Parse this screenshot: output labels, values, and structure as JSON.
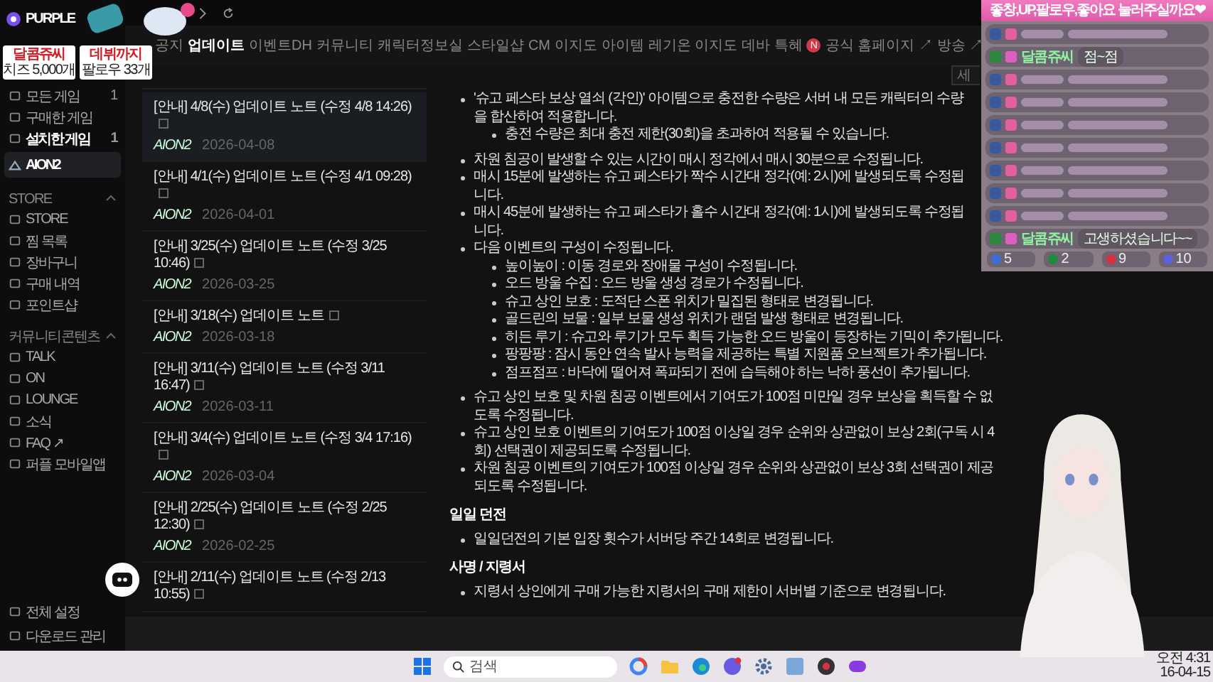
{
  "stream_overlay": {
    "cards": [
      {
        "title": "달콤쥬씨",
        "value": "치즈 5,000개"
      },
      {
        "title": "데뷔까지",
        "value": "팔로우 33개"
      }
    ]
  },
  "sidebar": {
    "logo": "PURPLE",
    "groups": [
      {
        "items": [
          {
            "label": "모든 게임",
            "badge": "1",
            "emphasized": false,
            "selected": false,
            "kind": "item"
          },
          {
            "label": "구매한 게임",
            "emphasized": false,
            "selected": false,
            "kind": "item"
          },
          {
            "label": "설치한 게임",
            "badge": "1",
            "emphasized": true,
            "selected": false,
            "kind": "item"
          },
          {
            "label": "AION2",
            "emphasized": true,
            "selected": true,
            "kind": "game"
          }
        ]
      },
      {
        "title": "STORE",
        "items": [
          {
            "label": "STORE",
            "emphasized": false,
            "selected": false,
            "kind": "item"
          },
          {
            "label": "찜 목록",
            "emphasized": false,
            "selected": false,
            "kind": "item"
          },
          {
            "label": "장바구니",
            "emphasized": false,
            "selected": false,
            "kind": "item"
          },
          {
            "label": "구매 내역",
            "emphasized": false,
            "selected": false,
            "kind": "item"
          },
          {
            "label": "포인트샵",
            "emphasized": false,
            "selected": false,
            "kind": "item"
          }
        ]
      },
      {
        "title": "커뮤니티콘텐츠",
        "items": [
          {
            "label": "TALK",
            "emphasized": false,
            "selected": false,
            "kind": "item"
          },
          {
            "label": "ON",
            "emphasized": false,
            "selected": false,
            "kind": "item"
          },
          {
            "label": "LOUNGE",
            "emphasized": false,
            "selected": false,
            "kind": "item"
          },
          {
            "label": "소식",
            "emphasized": false,
            "selected": false,
            "kind": "item"
          },
          {
            "label": "FAQ ↗",
            "emphasized": false,
            "selected": false,
            "kind": "item"
          },
          {
            "label": "퍼플 모바일앱",
            "emphasized": false,
            "selected": false,
            "kind": "item"
          }
        ]
      }
    ],
    "footer": [
      {
        "label": "전체 설정"
      },
      {
        "label": "다운로드 관리"
      }
    ]
  },
  "tabs": [
    {
      "label": "공지",
      "selected": false
    },
    {
      "label": "업데이트",
      "selected": true
    },
    {
      "label": "이벤트DH",
      "selected": false
    },
    {
      "label": "커뮤니티",
      "selected": false
    },
    {
      "label": "캐릭터정보실",
      "selected": false
    },
    {
      "label": "스타일샵",
      "selected": false
    },
    {
      "label": "CM 이지도",
      "selected": false
    },
    {
      "label": "아이템",
      "selected": false
    },
    {
      "label": "레기온 이지도",
      "selected": false
    },
    {
      "label": "데바 특혜",
      "badge": "N",
      "selected": false
    },
    {
      "label": "공식 홈페이지 ↗",
      "selected": false
    },
    {
      "label": "방송 ↗",
      "selected": false
    }
  ],
  "search": {
    "placeholder": "세"
  },
  "posts": [
    {
      "title": "[안내] 4/8(수) 업데이트 노트 (수정 4/8 14:26)",
      "logo": "AION2",
      "date": "2026-04-08",
      "selected": true
    },
    {
      "title": "[안내] 4/1(수) 업데이트 노트 (수정 4/1 09:28)",
      "logo": "AION2",
      "date": "2026-04-01",
      "selected": false
    },
    {
      "title": "[안내] 3/25(수) 업데이트 노트 (수정 3/25 10:46)",
      "logo": "AION2",
      "date": "2026-03-25",
      "selected": false
    },
    {
      "title": "[안내] 3/18(수) 업데이트 노트",
      "logo": "AION2",
      "date": "2026-03-18",
      "selected": false
    },
    {
      "title": "[안내] 3/11(수) 업데이트 노트 (수정 3/11 16:47)",
      "logo": "AION2",
      "date": "2026-03-11",
      "selected": false
    },
    {
      "title": "[안내] 3/4(수) 업데이트 노트 (수정 3/4 17:16)",
      "logo": "AION2",
      "date": "2026-03-04",
      "selected": false
    },
    {
      "title": "[안내] 2/25(수) 업데이트 노트 (수정 2/25 12:30)",
      "logo": "AION2",
      "date": "2026-02-25",
      "selected": false
    },
    {
      "title": "[안내] 2/11(수) 업데이트 노트 (수정 2/13 10:55)",
      "selected": false
    }
  ],
  "article": {
    "blocks": [
      {
        "kind": "list",
        "items": [
          {
            "text": "'슈고 페스타 보상 열쇠 (각인)' 아이템으로 충전한 수량은 서버 내 모든 캐릭터의 수량을 합산하여 적용합니다.",
            "children": [
              "충전 수량은 최대 충전 제한(30회)을 초과하여 적용될 수 있습니다."
            ]
          }
        ]
      },
      {
        "kind": "list",
        "items": [
          {
            "text": "차원 침공이 발생할 수 있는 시간이 매시 정각에서 매시 30분으로 수정됩니다."
          },
          {
            "text": "매시 15분에 발생하는 슈고 페스타가 짝수 시간대 정각(예: 2시)에 발생되도록 수정됩니다."
          },
          {
            "text": "매시 45분에 발생하는 슈고 페스타가 홀수 시간대 정각(예: 1시)에 발생되도록 수정됩니다."
          },
          {
            "text": "다음 이벤트의 구성이 수정됩니다.",
            "children": [
              "높이높이 : 이동 경로와 장애물 구성이 수정됩니다.",
              "오드 방울 수집 : 오드 방울 생성 경로가 수정됩니다.",
              "슈고 상인 보호 : 도적단 스폰 위치가 밀집된 형태로 변경됩니다.",
              "골드린의 보물 : 일부 보물 생성 위치가 랜덤 발생 형태로 변경됩니다.",
              "히든 루기 : 슈고와 루기가 모두 획득 가능한 오드 방울이 등장하는 기믹이 추가됩니다.",
              "팡팡팡 : 잠시 동안 연속 발사 능력을 제공하는 특별 지원품 오브젝트가 추가됩니다.",
              "점프점프 : 바닥에 떨어져 폭파되기 전에 습득해야 하는 낙하 풍선이 추가됩니다."
            ]
          }
        ]
      },
      {
        "kind": "list",
        "items": [
          {
            "text": "슈고 상인 보호 및 차원 침공 이벤트에서 기여도가 100점 미만일 경우 보상을 획득할 수 없도록 수정됩니다."
          },
          {
            "text": "슈고 상인 보호 이벤트의 기여도가 100점 이상일 경우 순위와 상관없이 보상 2회(구독 시 4회) 선택권이 제공되도록 수정됩니다."
          },
          {
            "text": "차원 침공 이벤트의 기여도가 100점 이상일 경우 순위와 상관없이 보상 3회 선택권이 제공되도록 수정됩니다."
          }
        ]
      },
      {
        "kind": "heading",
        "text": "일일 던전"
      },
      {
        "kind": "list",
        "items": [
          {
            "text": "일일던전의 기본 입장 횟수가 서버당 주간 14회로 변경됩니다."
          }
        ]
      },
      {
        "kind": "heading",
        "text": "사명 / 지령서"
      },
      {
        "kind": "list",
        "items": [
          {
            "text": "지령서 상인에게 구매 가능한 지령서의 구매 제한이 서버별 기준으로 변경됩니다."
          }
        ]
      }
    ]
  },
  "chat": {
    "header": "좋창,UP,팔로우,좋아요 눌러주실까요❤",
    "messages": [
      {
        "kind": "obscured"
      },
      {
        "kind": "text",
        "name": "달콤쥬씨",
        "message": "점~점",
        "color": "#8ff0a0"
      },
      {
        "kind": "obscured"
      },
      {
        "kind": "obscured"
      },
      {
        "kind": "obscured"
      },
      {
        "kind": "obscured"
      },
      {
        "kind": "obscured"
      },
      {
        "kind": "obscured"
      },
      {
        "kind": "obscured"
      },
      {
        "kind": "text",
        "name": "달콤쥬씨",
        "message": "고생하셨습니다~~",
        "color": "#8ff0a0"
      }
    ],
    "counters": [
      {
        "count": "5",
        "color": "#3a6fd8"
      },
      {
        "count": "2",
        "color": "#1f8a3a"
      },
      {
        "count": "9",
        "color": "#d8303c"
      },
      {
        "count": "10",
        "color": "#5a62e0"
      }
    ]
  },
  "taskbar": {
    "search_placeholder": "검색",
    "time": "오전 4:31",
    "date": "16-04-15"
  }
}
